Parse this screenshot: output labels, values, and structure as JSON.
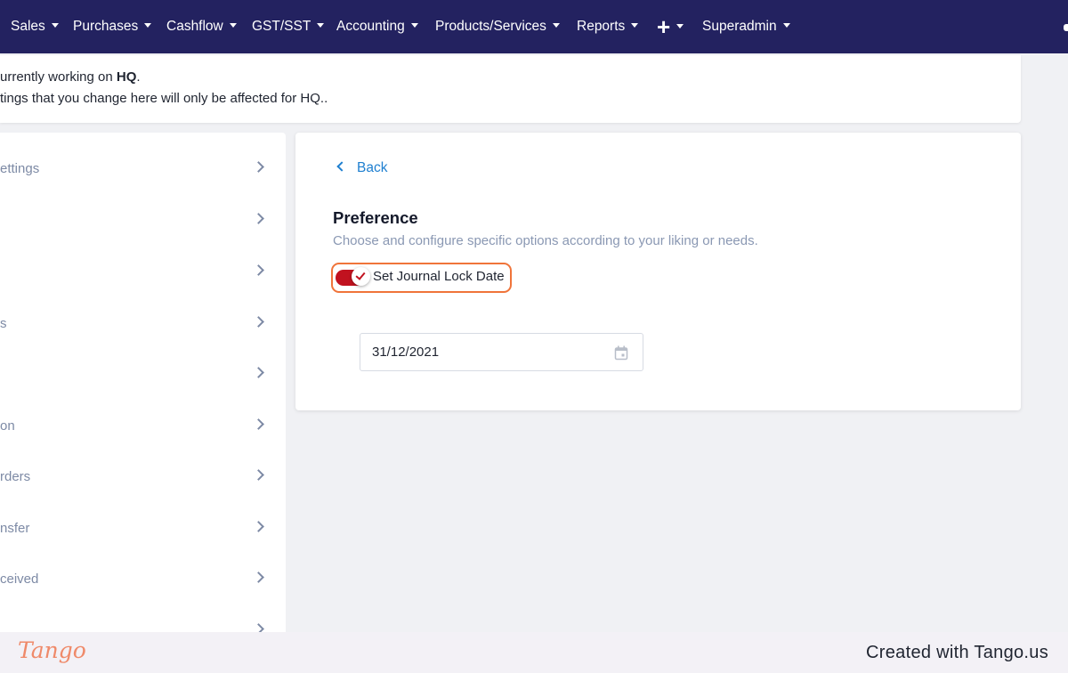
{
  "nav": {
    "items": [
      {
        "label": "Sales"
      },
      {
        "label": "Purchases"
      },
      {
        "label": "Cashflow"
      },
      {
        "label": "GST/SST"
      },
      {
        "label": "Accounting"
      },
      {
        "label": "Products/Services"
      },
      {
        "label": "Reports"
      },
      {
        "label": "+"
      },
      {
        "label": "Superadmin"
      }
    ],
    "background": "#232260"
  },
  "notice": {
    "line1_prefix": "urrently working on ",
    "line1_bold": "HQ",
    "line1_suffix": ".",
    "line2": "tings that you change here will only be affected for HQ.."
  },
  "sidebar": {
    "items": [
      {
        "label": "ettings"
      },
      {
        "label": ""
      },
      {
        "label": ""
      },
      {
        "label": "s"
      },
      {
        "label": ""
      },
      {
        "label": "on"
      },
      {
        "label": "rders"
      },
      {
        "label": "nsfer"
      },
      {
        "label": "ceived"
      },
      {
        "label": ""
      }
    ]
  },
  "panel": {
    "back_label": "Back",
    "title": "Preference",
    "subtitle": "Choose and configure specific options according to your liking or needs.",
    "toggle": {
      "label": "Set Journal Lock Date",
      "checked": true,
      "color": "#c1121f",
      "highlight": "#f0743a"
    },
    "date_field": {
      "value": "31/12/2021",
      "icon": "calendar-icon"
    }
  },
  "footer": {
    "logo": "Tango",
    "created": "Created with Tango.us"
  }
}
